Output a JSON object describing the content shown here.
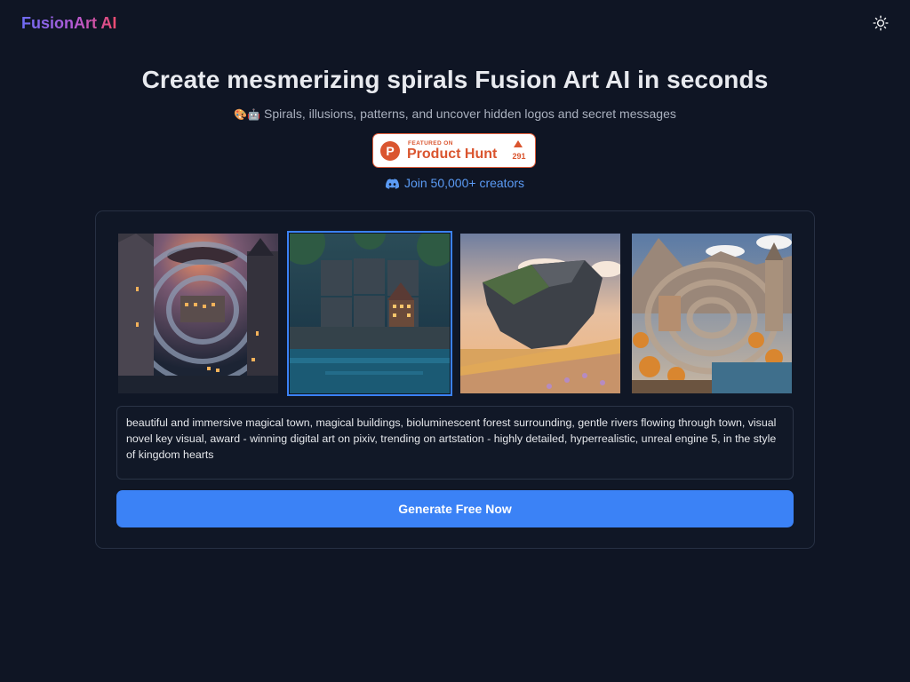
{
  "header": {
    "logo_text": "FusionArt AI",
    "theme_toggle_icon": "sun-icon"
  },
  "hero": {
    "title": "Create mesmerizing spirals Fusion Art AI in seconds",
    "subtitle_emoji": "🎨🤖",
    "subtitle": "Spirals, illusions, patterns, and uncover hidden logos and secret messages"
  },
  "product_hunt": {
    "featured_label": "FEATURED ON",
    "name": "Product Hunt",
    "logo_letter": "P",
    "upvotes": "291",
    "color": "#da552f"
  },
  "community": {
    "icon": "discord-icon",
    "label": "Join 50,000+ creators"
  },
  "gallery": {
    "selected_index": 1,
    "items": [
      {
        "name": "spiral-castle-town"
      },
      {
        "name": "magical-town-bioluminescent-forest"
      },
      {
        "name": "floating-rock-island"
      },
      {
        "name": "spiral-autumn-village"
      }
    ]
  },
  "prompt": {
    "value": "beautiful and immersive magical town, magical buildings, bioluminescent forest surrounding, gentle rivers flowing through town, visual novel key visual, award - winning digital art on pixiv, trending on artstation - highly detailed, hyperrealistic, unreal engine 5, in the style of kingdom hearts"
  },
  "actions": {
    "generate_label": "Generate Free Now"
  },
  "colors": {
    "background": "#0f1524",
    "accent": "#3b82f6",
    "link": "#5b9bf5"
  }
}
